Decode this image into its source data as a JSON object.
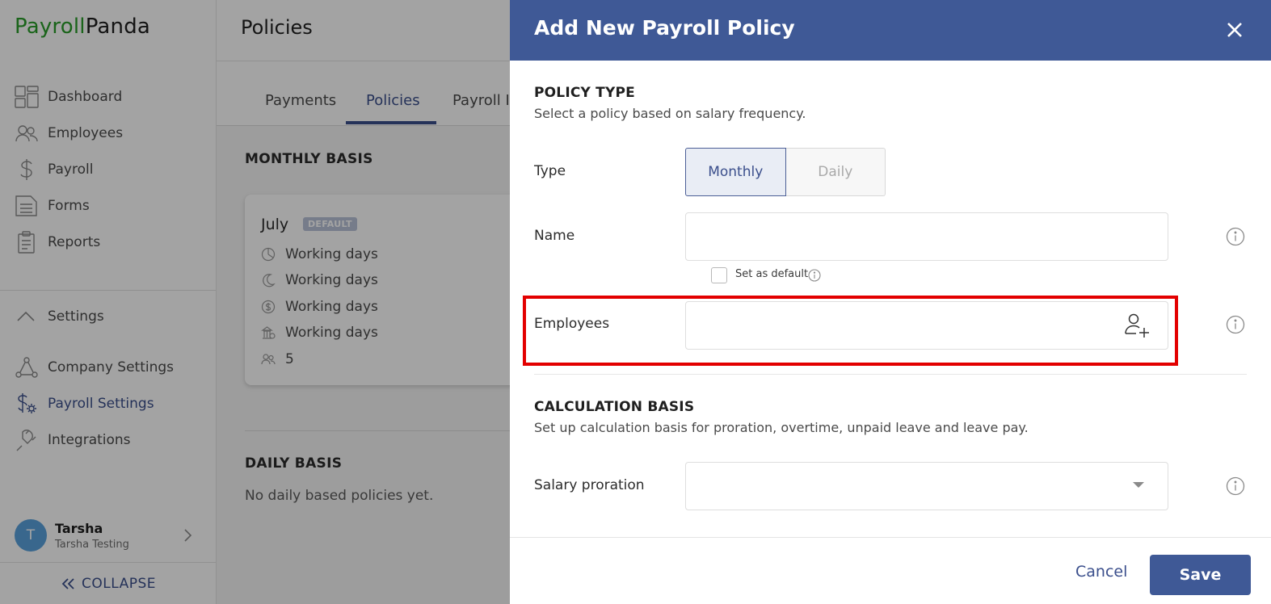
{
  "app": {
    "brand_part1": "Payroll",
    "brand_part2": "Panda"
  },
  "sidebar": {
    "items": [
      {
        "label": "Dashboard",
        "icon": "dashboard-icon"
      },
      {
        "label": "Employees",
        "icon": "people-icon"
      },
      {
        "label": "Payroll",
        "icon": "dollar-icon"
      },
      {
        "label": "Forms",
        "icon": "forms-icon"
      },
      {
        "label": "Reports",
        "icon": "clipboard-icon"
      }
    ],
    "settings_label": "Settings",
    "settings_items": [
      {
        "label": "Company Settings",
        "icon": "network-icon"
      },
      {
        "label": "Payroll Settings",
        "icon": "payroll-settings-icon",
        "active": true
      },
      {
        "label": "Integrations",
        "icon": "plug-icon"
      }
    ],
    "user": {
      "initial": "T",
      "name": "Tarsha",
      "company": "Tarsha Testing"
    },
    "collapse_label": "COLLAPSE"
  },
  "main": {
    "title": "Policies",
    "tabs": [
      {
        "label": "Payments"
      },
      {
        "label": "Policies",
        "active": true
      },
      {
        "label": "Payroll It"
      }
    ],
    "monthly_label": "MONTHLY BASIS",
    "card": {
      "title": "July",
      "badge": "DEFAULT",
      "rows": [
        {
          "icon": "pie-chart-icon",
          "text": "Working days"
        },
        {
          "icon": "moon-icon",
          "text": "Working days"
        },
        {
          "icon": "coin-icon",
          "text": "Working days"
        },
        {
          "icon": "bank-icon",
          "text": "Working days"
        },
        {
          "icon": "people-icon",
          "text": "5"
        }
      ]
    },
    "daily_label": "DAILY BASIS",
    "daily_empty": "No daily based policies yet."
  },
  "modal": {
    "title": "Add New Payroll Policy",
    "policy_type": {
      "heading": "POLICY TYPE",
      "description": "Select a policy based on salary frequency.",
      "type_label": "Type",
      "options": [
        "Monthly",
        "Daily"
      ],
      "selected": "Monthly"
    },
    "name": {
      "label": "Name",
      "value": "",
      "set_default_label": "Set as default",
      "set_default_checked": false
    },
    "employees": {
      "label": "Employees",
      "value": ""
    },
    "calculation": {
      "heading": "CALCULATION BASIS",
      "description": "Set up calculation basis for proration, overtime, unpaid leave and leave pay.",
      "salary_proration_label": "Salary proration",
      "salary_proration_value": ""
    },
    "footer": {
      "cancel_label": "Cancel",
      "save_label": "Save"
    }
  },
  "colors": {
    "brand_green": "#2a9d2a",
    "primary": "#3f5996",
    "highlight": "#e30000",
    "avatar": "#5aa2dd"
  }
}
